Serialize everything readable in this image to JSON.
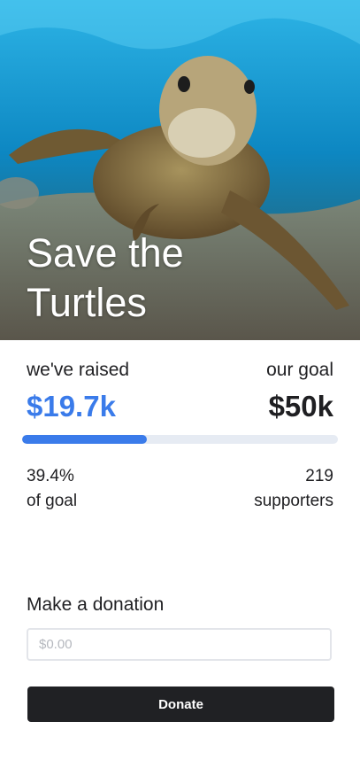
{
  "hero": {
    "title_line1": "Save the",
    "title_line2": "Turtles"
  },
  "stats": {
    "raised_label": "we've raised",
    "raised_value": "$19.7k",
    "goal_label": "our goal",
    "goal_value": "$50k",
    "progress_fraction": 0.394,
    "percent_text": "39.4%",
    "percent_caption": "of goal",
    "supporters_count": "219",
    "supporters_caption": "supporters"
  },
  "donation": {
    "heading": "Make a donation",
    "amount_placeholder": "$0.00",
    "button_label": "Donate"
  },
  "colors": {
    "accent": "#3a7bea",
    "button": "#202124",
    "track": "#e6ebf3"
  }
}
